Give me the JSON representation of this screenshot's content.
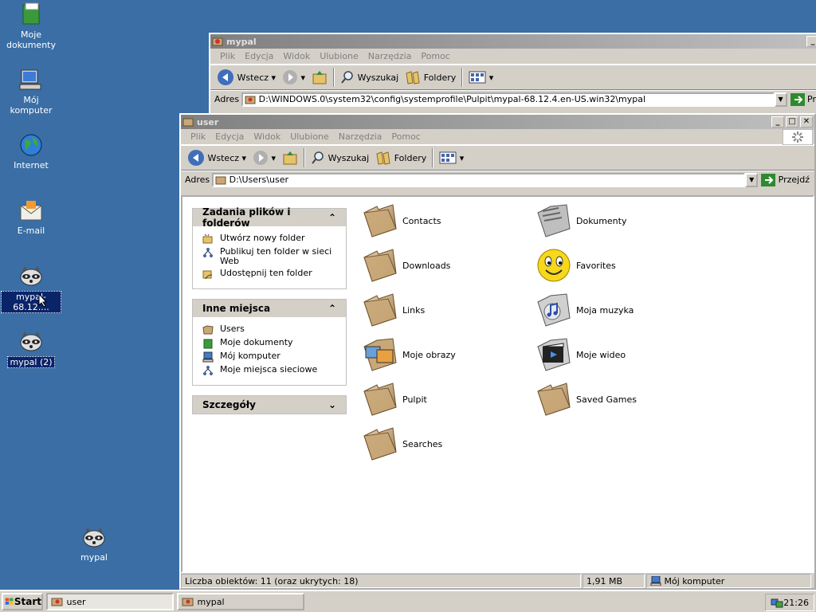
{
  "desktop": {
    "icons": [
      {
        "label": "Moje dokumenty"
      },
      {
        "label": "Mój komputer"
      },
      {
        "label": "Internet"
      },
      {
        "label": "E-mail"
      },
      {
        "label": "mypal-68.12...."
      },
      {
        "label": "mypal (2)"
      },
      {
        "label": "mypal"
      }
    ]
  },
  "back_window": {
    "title": "mypal",
    "menu": [
      "Plik",
      "Edycja",
      "Widok",
      "Ulubione",
      "Narzędzia",
      "Pomoc"
    ],
    "toolbar": {
      "back": "Wstecz",
      "search": "Wyszukaj",
      "folders": "Foldery"
    },
    "address_label": "Adres",
    "address": "D:\\WINDOWS.0\\system32\\config\\systemprofile\\Pulpit\\mypal-68.12.4.en-US.win32\\mypal",
    "go_label": "Pr"
  },
  "front_window": {
    "title": "user",
    "menu": [
      "Plik",
      "Edycja",
      "Widok",
      "Ulubione",
      "Narzędzia",
      "Pomoc"
    ],
    "toolbar": {
      "back": "Wstecz",
      "search": "Wyszukaj",
      "folders": "Foldery"
    },
    "address_label": "Adres",
    "address": "D:\\Users\\user",
    "go_label": "Przejdź",
    "panels": [
      {
        "title": "Zadania plików i folderów",
        "items": [
          "Utwórz nowy folder",
          "Publikuj ten folder w sieci Web",
          "Udostępnij ten folder"
        ]
      },
      {
        "title": "Inne miejsca",
        "items": [
          "Users",
          "Moje dokumenty",
          "Mój komputer",
          "Moje miejsca sieciowe"
        ]
      },
      {
        "title": "Szczegóły",
        "items": []
      }
    ],
    "files": [
      {
        "name": "Contacts",
        "icon": "folder"
      },
      {
        "name": "Dokumenty",
        "icon": "documents-folder"
      },
      {
        "name": "Downloads",
        "icon": "folder"
      },
      {
        "name": "Favorites",
        "icon": "favorites-smiley"
      },
      {
        "name": "Links",
        "icon": "folder"
      },
      {
        "name": "Moja muzyka",
        "icon": "music-folder"
      },
      {
        "name": "Moje obrazy",
        "icon": "pictures-folder"
      },
      {
        "name": "Moje wideo",
        "icon": "video-folder"
      },
      {
        "name": "Pulpit",
        "icon": "folder"
      },
      {
        "name": "Saved Games",
        "icon": "folder"
      },
      {
        "name": "Searches",
        "icon": "folder"
      }
    ],
    "status": {
      "count": "Liczba obiektów: 11 (oraz ukrytych: 18)",
      "size": "1,91 MB",
      "zone": "Mój komputer"
    }
  },
  "taskbar": {
    "start": "Start",
    "tasks": [
      {
        "label": "user"
      },
      {
        "label": "mypal"
      }
    ],
    "clock": "21:26"
  },
  "colors": {
    "desktop": "#3a6ea5",
    "face": "#d4d0c8",
    "selection": "#0a246a"
  }
}
